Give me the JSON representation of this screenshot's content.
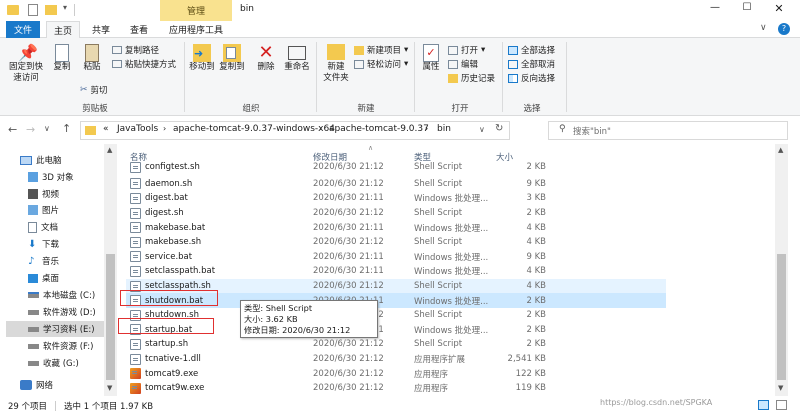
{
  "window": {
    "title": "bin",
    "context_tab": "管理",
    "controls": {
      "minimize": "—",
      "maximize": "☐",
      "close": "✕"
    }
  },
  "ribbon_tabs": [
    "文件",
    "主页",
    "共享",
    "查看",
    "应用程序工具"
  ],
  "ribbon": {
    "pin": "固定到快\n速访问",
    "copy": "复制",
    "paste": "粘贴",
    "copy_path": "复制路径",
    "paste_shortcut": "粘贴快捷方式",
    "cut": "剪切",
    "clipboard_group": "剪贴板",
    "move_to": "移动到",
    "copy_to": "复制到",
    "delete": "删除",
    "rename": "重命名",
    "organize_group": "组织",
    "new_folder": "新建\n文件夹",
    "new_item": "新建项目",
    "easy_access": "轻松访问",
    "new_group": "新建",
    "properties": "属性",
    "open": "打开",
    "edit": "编辑",
    "history": "历史记录",
    "open_group": "打开",
    "select_all": "全部选择",
    "select_none": "全部取消",
    "invert": "反向选择",
    "select_group": "选择"
  },
  "address": {
    "crumbs": [
      "«",
      "JavaTools",
      "apache-tomcat-9.0.37-windows-x64",
      "apache-tomcat-9.0.37",
      "bin"
    ],
    "search_placeholder": "搜索\"bin\""
  },
  "nav": [
    {
      "label": "此电脑",
      "icon": "computer-icon",
      "indent": 0
    },
    {
      "label": "3D 对象",
      "icon": "3d-objects-icon",
      "indent": 1
    },
    {
      "label": "视频",
      "icon": "video-icon",
      "indent": 1
    },
    {
      "label": "图片",
      "icon": "picture-icon",
      "indent": 1
    },
    {
      "label": "文档",
      "icon": "document-icon",
      "indent": 1
    },
    {
      "label": "下载",
      "icon": "download-icon",
      "indent": 1
    },
    {
      "label": "音乐",
      "icon": "music-icon",
      "indent": 1
    },
    {
      "label": "桌面",
      "icon": "desktop-icon",
      "indent": 1
    },
    {
      "label": "本地磁盘 (C:)",
      "icon": "drive-c-icon",
      "indent": 1
    },
    {
      "label": "软件游戏 (D:)",
      "icon": "drive-icon",
      "indent": 1
    },
    {
      "label": "学习资料 (E:)",
      "icon": "drive-icon",
      "indent": 1,
      "selected": true
    },
    {
      "label": "软件资源 (F:)",
      "icon": "drive-icon",
      "indent": 1
    },
    {
      "label": "收藏 (G:)",
      "icon": "drive-icon",
      "indent": 1
    },
    {
      "label": "网络",
      "icon": "network-icon",
      "indent": 0
    }
  ],
  "columns": {
    "name": "名称",
    "date": "修改日期",
    "type": "类型",
    "size": "大小"
  },
  "files": [
    {
      "name": "configtest.sh",
      "date": "2020/6/30 21:12",
      "type": "Shell Script",
      "size": "2 KB",
      "partial": true
    },
    {
      "name": "daemon.sh",
      "date": "2020/6/30 21:12",
      "type": "Shell Script",
      "size": "9 KB"
    },
    {
      "name": "digest.bat",
      "date": "2020/6/30 21:11",
      "type": "Windows 批处理...",
      "size": "3 KB"
    },
    {
      "name": "digest.sh",
      "date": "2020/6/30 21:12",
      "type": "Shell Script",
      "size": "2 KB"
    },
    {
      "name": "makebase.bat",
      "date": "2020/6/30 21:11",
      "type": "Windows 批处理...",
      "size": "4 KB"
    },
    {
      "name": "makebase.sh",
      "date": "2020/6/30 21:12",
      "type": "Shell Script",
      "size": "4 KB"
    },
    {
      "name": "service.bat",
      "date": "2020/6/30 21:11",
      "type": "Windows 批处理...",
      "size": "9 KB"
    },
    {
      "name": "setclasspath.bat",
      "date": "2020/6/30 21:11",
      "type": "Windows 批处理...",
      "size": "4 KB"
    },
    {
      "name": "setclasspath.sh",
      "date": "2020/6/30 21:12",
      "type": "Shell Script",
      "size": "4 KB",
      "hover": true
    },
    {
      "name": "shutdown.bat",
      "date": "2020/6/30 21:11",
      "type": "Windows 批处理...",
      "size": "2 KB",
      "selected": true,
      "boxed": true
    },
    {
      "name": "shutdown.sh",
      "date": "2020/6/30 21:12",
      "type": "Shell Script",
      "size": "2 KB"
    },
    {
      "name": "startup.bat",
      "date": "2020/6/30 21:11",
      "type": "Windows 批处理...",
      "size": "2 KB",
      "boxed": true
    },
    {
      "name": "startup.sh",
      "date": "2020/6/30 21:12",
      "type": "Shell Script",
      "size": "2 KB"
    },
    {
      "name": "tcnative-1.dll",
      "date": "2020/6/30 21:12",
      "type": "应用程序扩展",
      "size": "2,541 KB"
    },
    {
      "name": "tomcat9.exe",
      "date": "2020/6/30 21:12",
      "type": "应用程序",
      "size": "122 KB"
    },
    {
      "name": "tomcat9w.exe",
      "date": "2020/6/30 21:12",
      "type": "应用程序",
      "size": "119 KB"
    }
  ],
  "tooltip": {
    "type": "类型: Shell Script",
    "size": "大小: 3.62 KB",
    "date": "修改日期: 2020/6/30 21:12"
  },
  "status": {
    "count": "29 个项目",
    "selected": "选中 1 个项目  1.97 KB"
  },
  "watermark": "https://blog.csdn.net/SPGKA",
  "colors": {
    "accent": "#1979ca",
    "selection": "#cce8ff",
    "hover": "#e5f3ff",
    "highlight_box": "#e03030",
    "context_tab": "#f9e28f"
  }
}
